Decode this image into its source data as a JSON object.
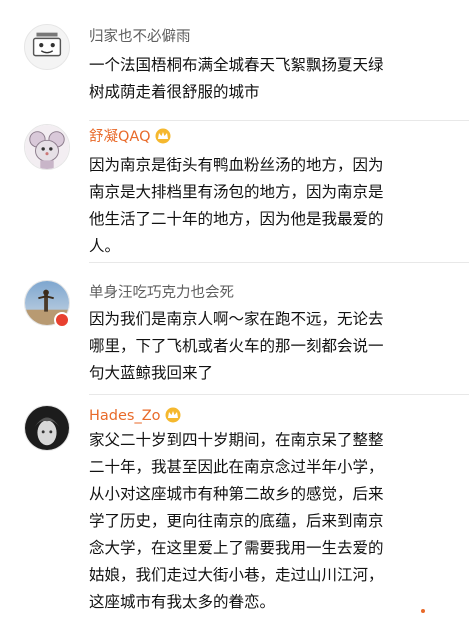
{
  "comments": [
    {
      "username": "归家也不必僻雨",
      "verified_badge": false,
      "lines": [
        "一个法国梧桐布满全城春天飞絮飘扬夏天绿",
        "树成荫走着很舒服的城市"
      ]
    },
    {
      "username": "舒凝QAQ",
      "verified_badge": true,
      "lines": [
        "因为南京是街头有鸭血粉丝汤的地方，因为",
        "南京是大排档里有汤包的地方，因为南京是",
        "他生活了二十年的地方，因为他是我最爱的",
        "人。"
      ]
    },
    {
      "username": "单身汪吃巧克力也会死",
      "verified_badge": false,
      "lines": [
        "因为我们是南京人啊～家在跑不远，无论去",
        "哪里，下了飞机或者火车的那一刻都会说一",
        "句大蓝鲸我回来了"
      ]
    },
    {
      "username": "Hades_Zo",
      "verified_badge": true,
      "lines": [
        "家父二十岁到四十岁期间，在南京呆了整整",
        "二十年，我甚至因此在南京念过半年小学，",
        "从小对这座城市有种第二故乡的感觉，后来",
        "学了历史，更向往南京的底蕴，后来到南京",
        "念大学，在这里爱上了需要我用一生去爱的",
        "姑娘，我们走过大街小巷，走过山川江河，",
        "这座城市有我太多的眷恋。"
      ]
    }
  ],
  "colors": {
    "username_plain": "#5e5e5e",
    "username_link": "#e86a2a",
    "text": "#111111",
    "divider": "#e8e8e8",
    "vip_badge": "#e8402f"
  }
}
